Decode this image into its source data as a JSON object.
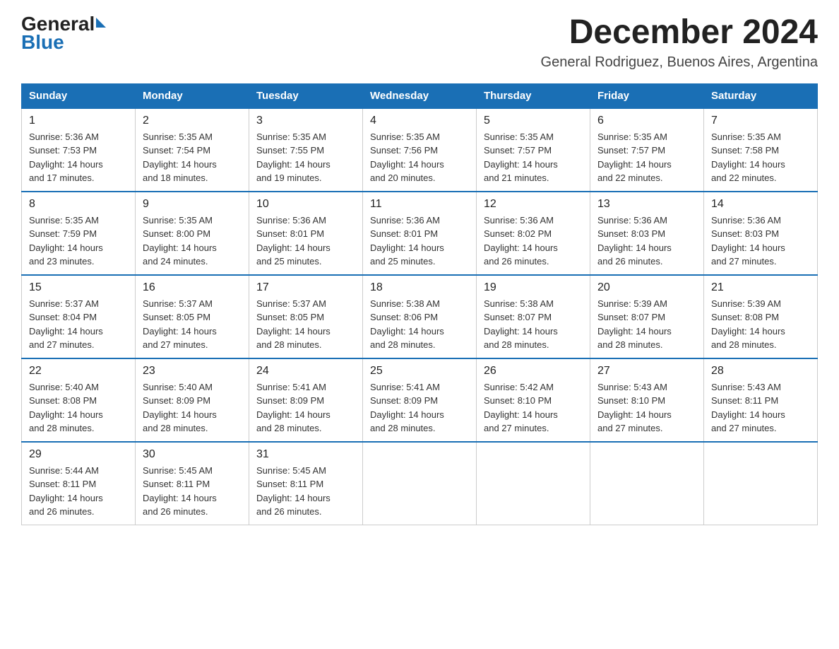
{
  "header": {
    "logo_general": "General",
    "logo_blue": "Blue",
    "month_title": "December 2024",
    "location": "General Rodriguez, Buenos Aires, Argentina"
  },
  "weekdays": [
    "Sunday",
    "Monday",
    "Tuesday",
    "Wednesday",
    "Thursday",
    "Friday",
    "Saturday"
  ],
  "weeks": [
    [
      {
        "day": "1",
        "sunrise": "5:36 AM",
        "sunset": "7:53 PM",
        "daylight": "14 hours and 17 minutes."
      },
      {
        "day": "2",
        "sunrise": "5:35 AM",
        "sunset": "7:54 PM",
        "daylight": "14 hours and 18 minutes."
      },
      {
        "day": "3",
        "sunrise": "5:35 AM",
        "sunset": "7:55 PM",
        "daylight": "14 hours and 19 minutes."
      },
      {
        "day": "4",
        "sunrise": "5:35 AM",
        "sunset": "7:56 PM",
        "daylight": "14 hours and 20 minutes."
      },
      {
        "day": "5",
        "sunrise": "5:35 AM",
        "sunset": "7:57 PM",
        "daylight": "14 hours and 21 minutes."
      },
      {
        "day": "6",
        "sunrise": "5:35 AM",
        "sunset": "7:57 PM",
        "daylight": "14 hours and 22 minutes."
      },
      {
        "day": "7",
        "sunrise": "5:35 AM",
        "sunset": "7:58 PM",
        "daylight": "14 hours and 22 minutes."
      }
    ],
    [
      {
        "day": "8",
        "sunrise": "5:35 AM",
        "sunset": "7:59 PM",
        "daylight": "14 hours and 23 minutes."
      },
      {
        "day": "9",
        "sunrise": "5:35 AM",
        "sunset": "8:00 PM",
        "daylight": "14 hours and 24 minutes."
      },
      {
        "day": "10",
        "sunrise": "5:36 AM",
        "sunset": "8:01 PM",
        "daylight": "14 hours and 25 minutes."
      },
      {
        "day": "11",
        "sunrise": "5:36 AM",
        "sunset": "8:01 PM",
        "daylight": "14 hours and 25 minutes."
      },
      {
        "day": "12",
        "sunrise": "5:36 AM",
        "sunset": "8:02 PM",
        "daylight": "14 hours and 26 minutes."
      },
      {
        "day": "13",
        "sunrise": "5:36 AM",
        "sunset": "8:03 PM",
        "daylight": "14 hours and 26 minutes."
      },
      {
        "day": "14",
        "sunrise": "5:36 AM",
        "sunset": "8:03 PM",
        "daylight": "14 hours and 27 minutes."
      }
    ],
    [
      {
        "day": "15",
        "sunrise": "5:37 AM",
        "sunset": "8:04 PM",
        "daylight": "14 hours and 27 minutes."
      },
      {
        "day": "16",
        "sunrise": "5:37 AM",
        "sunset": "8:05 PM",
        "daylight": "14 hours and 27 minutes."
      },
      {
        "day": "17",
        "sunrise": "5:37 AM",
        "sunset": "8:05 PM",
        "daylight": "14 hours and 28 minutes."
      },
      {
        "day": "18",
        "sunrise": "5:38 AM",
        "sunset": "8:06 PM",
        "daylight": "14 hours and 28 minutes."
      },
      {
        "day": "19",
        "sunrise": "5:38 AM",
        "sunset": "8:07 PM",
        "daylight": "14 hours and 28 minutes."
      },
      {
        "day": "20",
        "sunrise": "5:39 AM",
        "sunset": "8:07 PM",
        "daylight": "14 hours and 28 minutes."
      },
      {
        "day": "21",
        "sunrise": "5:39 AM",
        "sunset": "8:08 PM",
        "daylight": "14 hours and 28 minutes."
      }
    ],
    [
      {
        "day": "22",
        "sunrise": "5:40 AM",
        "sunset": "8:08 PM",
        "daylight": "14 hours and 28 minutes."
      },
      {
        "day": "23",
        "sunrise": "5:40 AM",
        "sunset": "8:09 PM",
        "daylight": "14 hours and 28 minutes."
      },
      {
        "day": "24",
        "sunrise": "5:41 AM",
        "sunset": "8:09 PM",
        "daylight": "14 hours and 28 minutes."
      },
      {
        "day": "25",
        "sunrise": "5:41 AM",
        "sunset": "8:09 PM",
        "daylight": "14 hours and 28 minutes."
      },
      {
        "day": "26",
        "sunrise": "5:42 AM",
        "sunset": "8:10 PM",
        "daylight": "14 hours and 27 minutes."
      },
      {
        "day": "27",
        "sunrise": "5:43 AM",
        "sunset": "8:10 PM",
        "daylight": "14 hours and 27 minutes."
      },
      {
        "day": "28",
        "sunrise": "5:43 AM",
        "sunset": "8:11 PM",
        "daylight": "14 hours and 27 minutes."
      }
    ],
    [
      {
        "day": "29",
        "sunrise": "5:44 AM",
        "sunset": "8:11 PM",
        "daylight": "14 hours and 26 minutes."
      },
      {
        "day": "30",
        "sunrise": "5:45 AM",
        "sunset": "8:11 PM",
        "daylight": "14 hours and 26 minutes."
      },
      {
        "day": "31",
        "sunrise": "5:45 AM",
        "sunset": "8:11 PM",
        "daylight": "14 hours and 26 minutes."
      },
      null,
      null,
      null,
      null
    ]
  ],
  "labels": {
    "sunrise": "Sunrise:",
    "sunset": "Sunset:",
    "daylight": "Daylight:"
  }
}
